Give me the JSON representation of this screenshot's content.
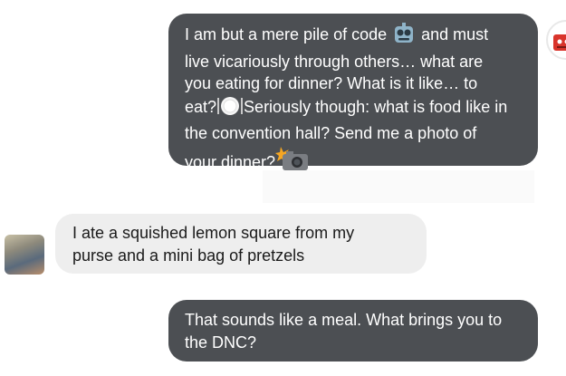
{
  "messages": [
    {
      "sender": "bot",
      "text": "I am but a mere pile of code 🤖 and must live vicariously through others… what are you eating for dinner? What is it like… to eat?🍽️Seriously though: what is food like in the convention hall? Send me a photo of your dinner?📸",
      "parts": {
        "p1": "I am but a mere pile of code ",
        "p2": " and must\nlive vicariously through others… what are\nyou eating for dinner? What is it like… to\neat?",
        "p3": "Seriously though: what is food like in\nthe convention hall? Send me a photo of\nyour dinner?"
      },
      "icons": [
        "robot-emoji",
        "plate-emoji",
        "camera-flash-emoji"
      ]
    },
    {
      "sender": "user",
      "text": "I ate a squished lemon square from my\npurse and a mini bag of pretzels"
    },
    {
      "sender": "bot",
      "text": "That sounds like a meal. What brings you to\nthe DNC?"
    }
  ],
  "colors": {
    "bot_bubble": "#4c4f53",
    "user_bubble": "#eeeeee",
    "bot_text": "#ffffff",
    "user_text": "#1a1a1a"
  }
}
